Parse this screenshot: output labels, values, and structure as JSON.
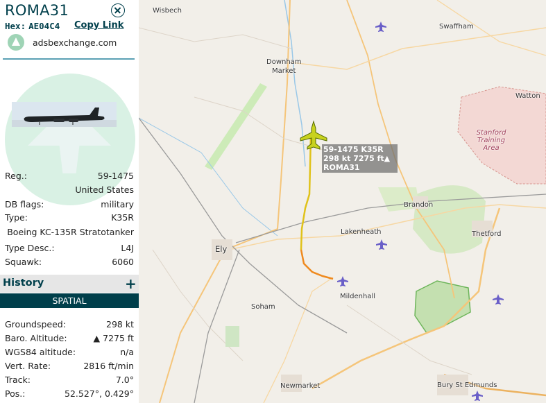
{
  "header": {
    "callsign": "ROMA31",
    "hex_label": "Hex:",
    "hex": "AE04C4",
    "copy_link": "Copy Link",
    "source": "adsbexchange.com"
  },
  "details": [
    {
      "label": "Reg.:",
      "value": "59-1475"
    },
    {
      "label": "",
      "value": "United States"
    },
    {
      "label": "DB flags:",
      "value": "military"
    },
    {
      "label": "Type:",
      "value": "K35R"
    },
    {
      "label": "",
      "value": "Boeing KC-135R Stratotanker"
    },
    {
      "label": "Type Desc.:",
      "value": "L4J"
    },
    {
      "label": "Squawk:",
      "value": "6060"
    }
  ],
  "history": {
    "title": "History",
    "toggle": "+"
  },
  "spatial": {
    "title": "SPATIAL"
  },
  "spatial_rows": [
    {
      "label": "Groundspeed:",
      "value": "298 kt"
    },
    {
      "label": "Baro. Altitude:",
      "value": "▲ 7275 ft"
    },
    {
      "label": "WGS84 altitude:",
      "value": "n/a"
    },
    {
      "label": "Vert. Rate:",
      "value": "2816 ft/min"
    },
    {
      "label": "Track:",
      "value": "7.0°"
    },
    {
      "label": "Pos.:",
      "value": "52.527°, 0.429°"
    }
  ],
  "map": {
    "aircraft_label": {
      "line1": "59-1475 K35R",
      "line2": "298 kt  7275 ft▲",
      "line3": "ROMA31"
    },
    "places": {
      "wisbech": "Wisbech",
      "swaffham": "Swaffham",
      "downham": "Downham",
      "market": "Market",
      "watton": "Watton",
      "stanford1": "Stanford",
      "stanford2": "Training",
      "stanford3": "Area",
      "brandon": "Brandon",
      "lakenheath": "Lakenheath",
      "thetford": "Thetford",
      "ely": "Ely",
      "mildenhall": "Mildenhall",
      "soham": "Soham",
      "newmarket": "Newmarket",
      "bury": "Bury St Edmunds"
    },
    "colors": {
      "aircraft": "#c8d21e",
      "track_yellow": "#e0c21a",
      "track_orange": "#ef8a1f",
      "forest": "#d6e9c5",
      "military_area": "#f3d3d0"
    }
  }
}
